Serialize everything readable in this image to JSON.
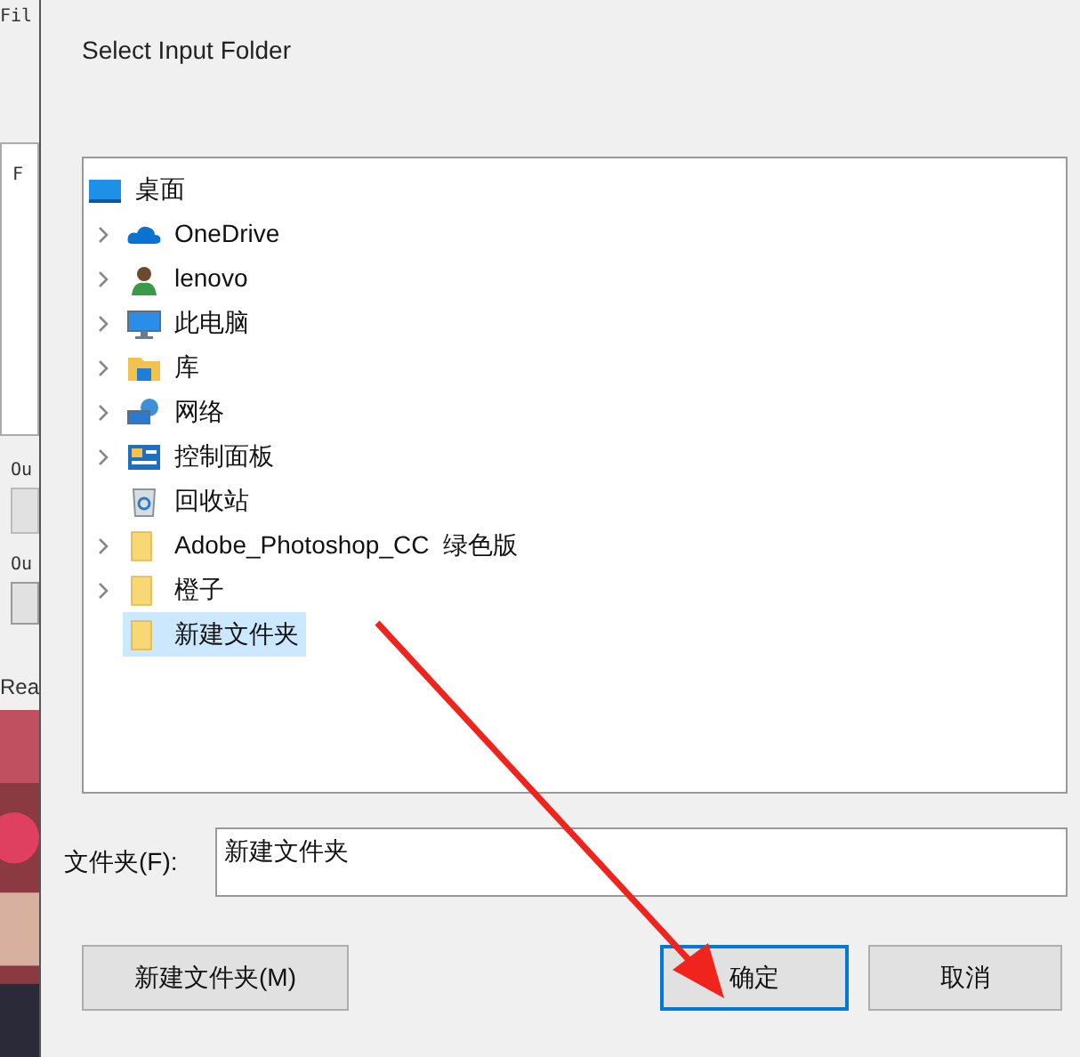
{
  "background_app": {
    "texts": [
      "Fil",
      "F",
      "Ou",
      "Ou",
      "Rea"
    ]
  },
  "dialog": {
    "title": "Select Input Folder",
    "tree": {
      "label": "桌面",
      "kind": "desktop",
      "expandable": false,
      "selected": false,
      "children": [
        {
          "label": "OneDrive",
          "kind": "cloud",
          "expandable": true,
          "selected": false
        },
        {
          "label": "lenovo",
          "kind": "user",
          "expandable": true,
          "selected": false
        },
        {
          "label": "此电脑",
          "kind": "computer",
          "expandable": true,
          "selected": false
        },
        {
          "label": "库",
          "kind": "library",
          "expandable": true,
          "selected": false
        },
        {
          "label": "网络",
          "kind": "network",
          "expandable": true,
          "selected": false
        },
        {
          "label": "控制面板",
          "kind": "control",
          "expandable": true,
          "selected": false
        },
        {
          "label": "回收站",
          "kind": "recycle",
          "expandable": false,
          "selected": false
        },
        {
          "label": "Adobe_Photoshop_CC  绿色版",
          "kind": "folder",
          "expandable": true,
          "selected": false
        },
        {
          "label": "橙子",
          "kind": "folder",
          "expandable": true,
          "selected": false
        },
        {
          "label": "新建文件夹",
          "kind": "folder",
          "expandable": false,
          "selected": true
        }
      ]
    },
    "folder_label": "文件夹(F):",
    "folder_value": "新建文件夹",
    "buttons": [
      {
        "label": "新建文件夹(M)",
        "default": false
      },
      {
        "label": "确定",
        "default": true
      },
      {
        "label": "取消",
        "default": false
      }
    ]
  },
  "annotation": {
    "kind": "arrow"
  }
}
